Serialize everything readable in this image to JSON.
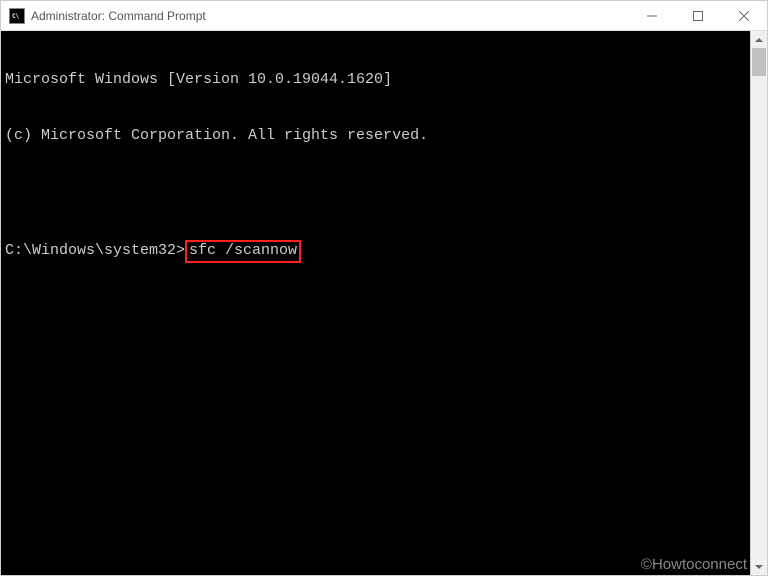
{
  "titlebar": {
    "icon_text": "C:\\",
    "title": "Administrator: Command Prompt"
  },
  "terminal": {
    "line1": "Microsoft Windows [Version 10.0.19044.1620]",
    "line2": "(c) Microsoft Corporation. All rights reserved.",
    "prompt": "C:\\Windows\\system32>",
    "command": "sfc /scannow"
  },
  "watermark": "©Howtoconnect"
}
